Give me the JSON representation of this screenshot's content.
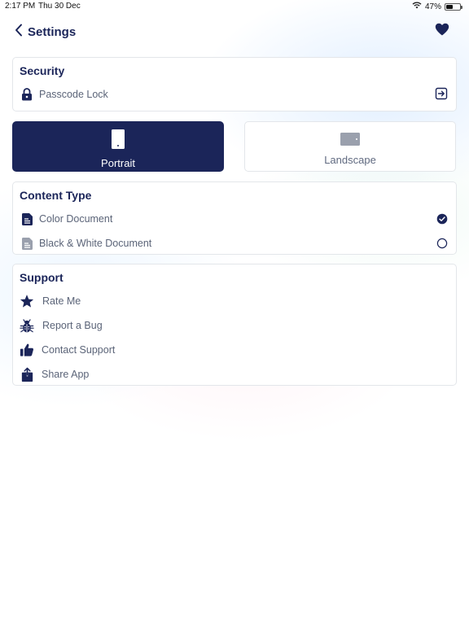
{
  "status_bar": {
    "time": "2:17 PM",
    "date": "Thu 30 Dec",
    "battery": "47%",
    "battery_level": 0.47
  },
  "nav": {
    "back_title": "Settings",
    "back_icon": "chevron-left-icon",
    "favorite_icon": "heart-icon"
  },
  "security": {
    "title": "Security",
    "passcode_label": "Passcode Lock",
    "passcode_icon": "lock-icon",
    "action_icon": "arrow-right-box-icon"
  },
  "orientation": {
    "portrait_label": "Portrait",
    "landscape_label": "Landscape",
    "selected": "Portrait"
  },
  "content_type": {
    "title": "Content Type",
    "options": [
      {
        "label": "Color Document",
        "selected": true
      },
      {
        "label": "Black & White Document",
        "selected": false
      }
    ]
  },
  "support": {
    "title": "Support",
    "items": [
      {
        "label": "Rate Me",
        "icon": "star-icon"
      },
      {
        "label": "Report a Bug",
        "icon": "bug-icon"
      },
      {
        "label": "Contact Support",
        "icon": "thumbs-up-icon"
      },
      {
        "label": "Share App",
        "icon": "share-icon"
      }
    ]
  },
  "colors": {
    "primary": "#1b2559",
    "muted_text": "#5b6478",
    "border": "#e3e6ea",
    "inactive_icon": "#9aa0ad"
  }
}
